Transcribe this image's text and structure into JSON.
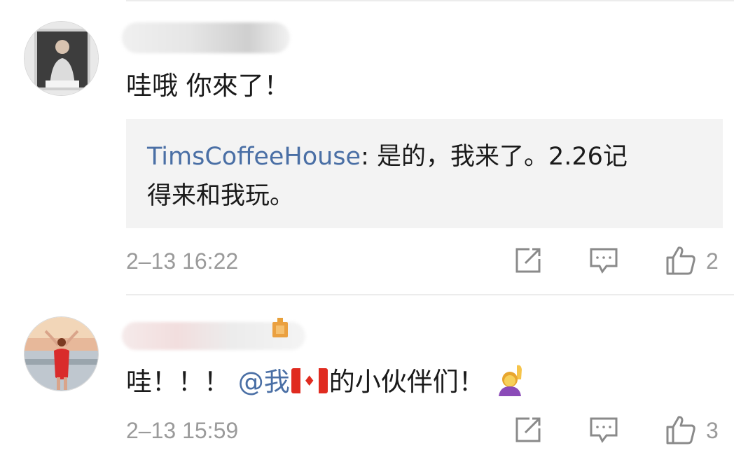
{
  "comments": [
    {
      "text": "哇哦 你來了！",
      "reply": {
        "user": "TimsCoffeeHouse",
        "line1": ": 是的，我来了。2.26记",
        "line2": "得来和我玩。"
      },
      "timestamp": "2–13 16:22",
      "likes": "2"
    },
    {
      "text_start": "哇！！！",
      "mention": "@我",
      "text_end": "的小伙伴们！",
      "timestamp": "2–13 15:59",
      "likes": "3"
    }
  ],
  "colors": {
    "mention": "#4a6fa5",
    "meta": "#9a9a9a",
    "reply_bg": "#f3f3f3"
  },
  "icons": [
    "share-icon",
    "comment-icon",
    "thumbs-up-icon",
    "canada-flag-icon",
    "person-raising-hand-icon"
  ]
}
